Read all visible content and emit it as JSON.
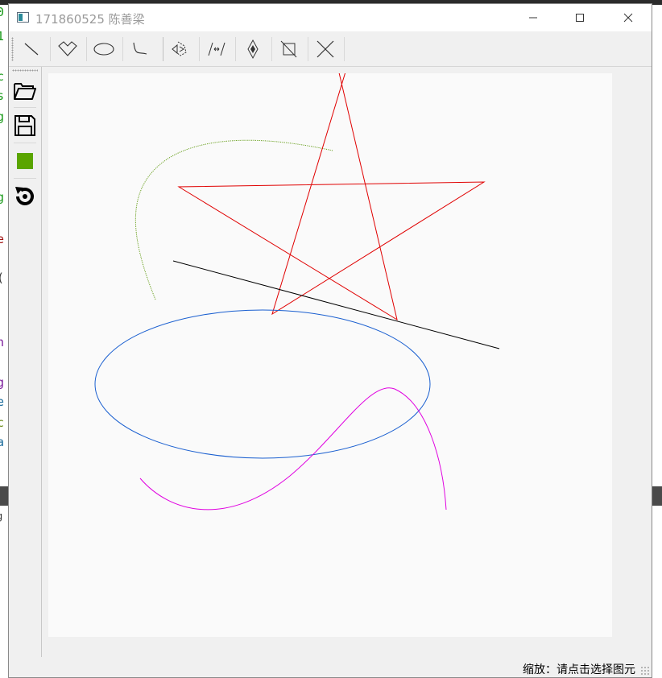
{
  "window": {
    "title": "171860525 陈善梁"
  },
  "toolbar": {
    "tools": [
      {
        "name": "line-tool-icon"
      },
      {
        "name": "polygon-tool-icon"
      },
      {
        "name": "ellipse-tool-icon"
      },
      {
        "name": "curve-tool-icon"
      },
      {
        "name": "translate-tool-icon"
      },
      {
        "name": "rotate-tool-icon"
      },
      {
        "name": "scale-tool-icon"
      },
      {
        "name": "clip-tool-icon"
      },
      {
        "name": "delete-tool-icon"
      }
    ]
  },
  "sidebar": {
    "items": [
      {
        "name": "open-folder-icon"
      },
      {
        "name": "save-icon"
      },
      {
        "name": "color-picker-swatch",
        "color": "#5aa500"
      },
      {
        "name": "reset-icon"
      }
    ]
  },
  "canvas": {
    "shapes": [
      {
        "type": "polyline",
        "name": "curve-green-dotted",
        "color": "#6aa020"
      },
      {
        "type": "polygon",
        "name": "star-polygon",
        "color": "#e00000"
      },
      {
        "type": "line",
        "name": "line-black",
        "color": "#000000"
      },
      {
        "type": "ellipse",
        "name": "ellipse-blue",
        "color": "#1a5fd0"
      },
      {
        "type": "curve",
        "name": "curve-magenta",
        "color": "#e000e0"
      }
    ]
  },
  "statusbar": {
    "text": "缩放：请点击选择图元"
  },
  "colors": {
    "window_bg": "#f0f0f0",
    "canvas_bg": "#fafafa",
    "title_text": "#9a9a9a"
  }
}
